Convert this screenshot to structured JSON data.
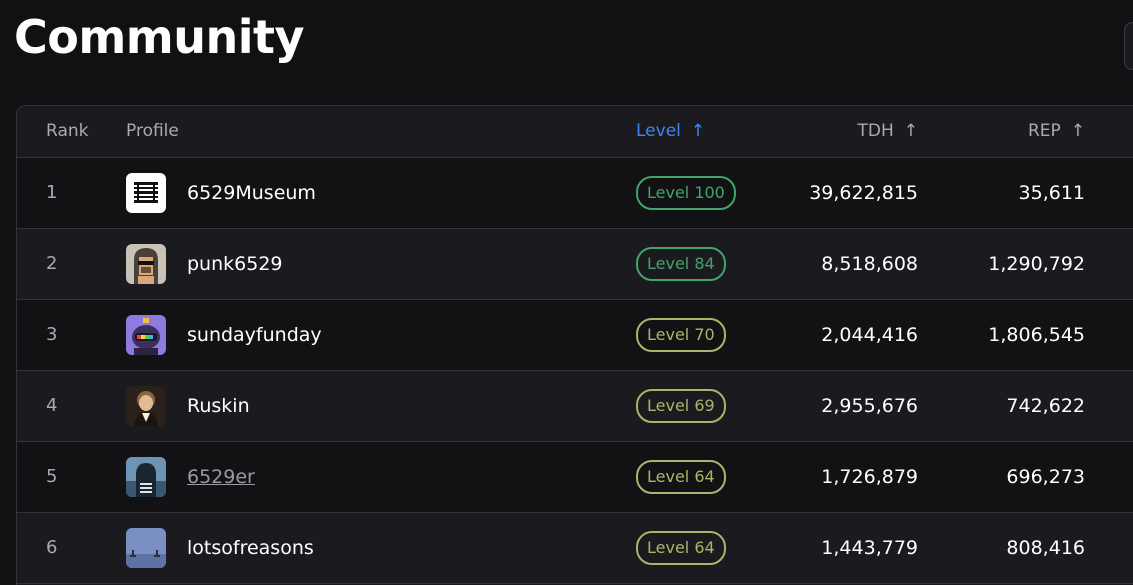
{
  "page": {
    "title": "Community"
  },
  "table": {
    "headers": {
      "rank": "Rank",
      "profile": "Profile",
      "level": "Level",
      "tdh": "TDH",
      "rep": "REP",
      "sort_arrow": "↑"
    },
    "active_sort": "level",
    "active_color": "#3d85f4",
    "rows": [
      {
        "rank": "1",
        "handle": "6529Museum",
        "level": "Level 100",
        "tdh": "39,622,815",
        "rep": "35,611",
        "avatar": "museum-logo-avatar",
        "badge_color": "#3fa56a",
        "linked": false
      },
      {
        "rank": "2",
        "handle": "punk6529",
        "level": "Level 84",
        "tdh": "8,518,608",
        "rep": "1,290,792",
        "avatar": "punk-avatar",
        "badge_color": "#3fa56a",
        "linked": false
      },
      {
        "rank": "3",
        "handle": "sundayfunday",
        "level": "Level 70",
        "tdh": "2,044,416",
        "rep": "1,806,545",
        "avatar": "purple-character-avatar",
        "badge_color": "#a9b56a",
        "linked": false
      },
      {
        "rank": "4",
        "handle": "Ruskin",
        "level": "Level 69",
        "tdh": "2,955,676",
        "rep": "742,622",
        "avatar": "portrait-avatar",
        "badge_color": "#a9b56a",
        "linked": false
      },
      {
        "rank": "5",
        "handle": "6529er",
        "level": "Level 64",
        "tdh": "1,726,879",
        "rep": "696,273",
        "avatar": "hooded-figure-avatar",
        "badge_color": "#a9b56a",
        "linked": true
      },
      {
        "rank": "6",
        "handle": "lotsofreasons",
        "level": "Level 64",
        "tdh": "1,443,779",
        "rep": "808,416",
        "avatar": "blue-scene-avatar",
        "badge_color": "#a9b56a",
        "linked": false
      }
    ]
  }
}
